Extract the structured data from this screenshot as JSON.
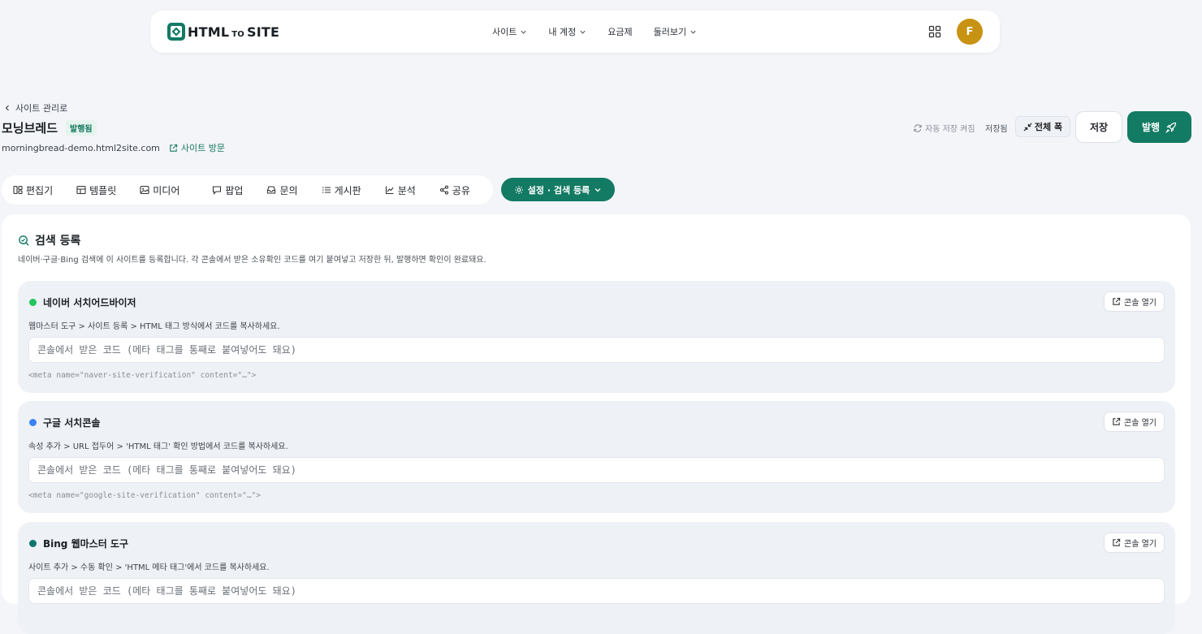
{
  "navbar": {
    "logo_text_1": "HTML",
    "logo_text_2": "TO",
    "logo_text_3": "SITE",
    "menu": [
      {
        "label": "사이트"
      },
      {
        "label": "내 계정"
      },
      {
        "label": "요금제"
      },
      {
        "label": "둘러보기"
      }
    ],
    "avatar_initial": "F"
  },
  "header": {
    "back_label": "사이트 관리로",
    "site_name": "모닝브레드",
    "status_badge": "발행됨",
    "domain": "morningbread-demo.html2site.com",
    "visit_label": "사이트 방문",
    "autosave_label": "자동 저장 켜짐",
    "saved_status": "저장됨",
    "fullwidth_label": "전체 폭",
    "save_label": "저장",
    "publish_label": "발행"
  },
  "tabs": [
    {
      "label": "편집기",
      "icon": "editor-icon"
    },
    {
      "label": "템플릿",
      "icon": "template-icon"
    },
    {
      "label": "미디어",
      "icon": "media-icon"
    },
    {
      "label": "팝업",
      "icon": "popup-icon"
    },
    {
      "label": "문의",
      "icon": "inbox-icon"
    },
    {
      "label": "게시판",
      "icon": "list-icon"
    },
    {
      "label": "분석",
      "icon": "chart-icon"
    },
    {
      "label": "공유",
      "icon": "share-icon"
    }
  ],
  "settings_tab": {
    "label": "설정 · 검색 등록"
  },
  "panel": {
    "title": "검색 등록",
    "description": "네이버·구글·Bing 검색에 이 사이트를 등록합니다. 각 콘솔에서 받은 소유확인 코드를 여기 붙여넣고 저장한 뒤, 발행하면 확인이 완료돼요.",
    "cards": [
      {
        "title": "네이버 서치어드바이저",
        "dot_color": "#22c55e",
        "hint": "웹마스터 도구 > 사이트 등록 > HTML 태그 방식에서 코드를 복사하세요.",
        "console_label": "콘솔 열기",
        "value": "",
        "placeholder": "콘솔에서 받은 코드 (메타 태그를 통째로 붙여넣어도 돼요)",
        "meta_example": "<meta name=\"naver-site-verification\" content=\"…\">"
      },
      {
        "title": "구글 서치콘솔",
        "dot_color": "#3b82f6",
        "hint": "속성 추가 > URL 접두어 > 'HTML 태그' 확인 방법에서 코드를 복사하세요.",
        "console_label": "콘솔 열기",
        "value": "",
        "placeholder": "콘솔에서 받은 코드 (메타 태그를 통째로 붙여넣어도 돼요)",
        "meta_example": "<meta name=\"google-site-verification\" content=\"…\">"
      },
      {
        "title": "Bing 웹마스터 도구",
        "dot_color": "#0f766e",
        "hint": "사이트 추가 > 수동 확인 > 'HTML 메타 태그'에서 코드를 복사하세요.",
        "console_label": "콘솔 열기",
        "value": "",
        "placeholder": "콘솔에서 받은 코드 (메타 태그를 통째로 붙여넣어도 돼요)",
        "meta_example": ""
      }
    ]
  }
}
